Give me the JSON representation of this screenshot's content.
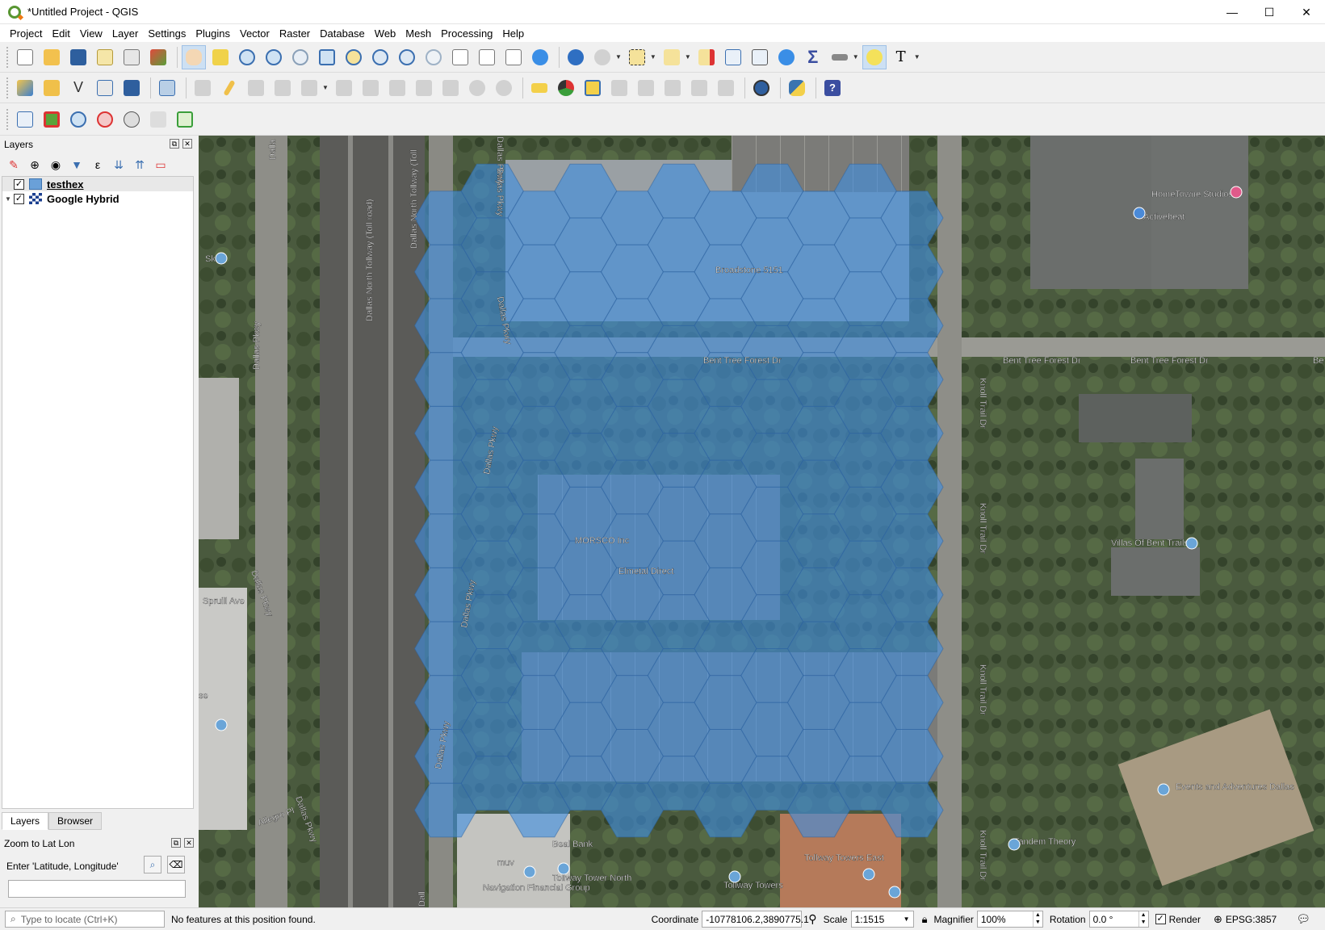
{
  "window": {
    "title": "*Untitled Project - QGIS",
    "minimize": "—",
    "maximize": "☐",
    "close": "✕"
  },
  "menu": [
    "Project",
    "Edit",
    "View",
    "Layer",
    "Settings",
    "Plugins",
    "Vector",
    "Raster",
    "Database",
    "Web",
    "Mesh",
    "Processing",
    "Help"
  ],
  "layers_panel": {
    "title": "Layers",
    "layers": [
      {
        "name": "testhex",
        "checked": true,
        "selected": true
      },
      {
        "name": "Google Hybrid",
        "checked": true,
        "selected": false
      }
    ]
  },
  "tabs": {
    "layers": "Layers",
    "browser": "Browser"
  },
  "zoom_panel": {
    "title": "Zoom to Lat Lon",
    "prompt": "Enter 'Latitude, Longitude'",
    "value": ""
  },
  "map": {
    "hex_color": "#3f8ee0",
    "labels": {
      "dnt1": "Dallas North Tollway (Toll road)",
      "dnt2": "Dallas North Tollway (Toll",
      "dallas_pkwy_top": "Dallas Pkwy",
      "dallas_pkwy_left": "Dallas Pkwy",
      "dallas_pkwy_left2": "Dallas Pkwy",
      "dallas_pkwy_bottom": "Dallas Pkwy",
      "dallas_pkwy_mid1": "Dallas Pkwy",
      "dallas_pkwy_mid2": "Dallas Pkwy",
      "dallas_pkwy_mid3": "Dallas Pkwy",
      "dallas_pkwy_mid4": "Dallas Pkwy",
      "dallas_pkwy_top2": "Dallas Pkwy",
      "dalla_top": "Dalla",
      "dall_bottom": "Dall",
      "broadstone": "Broadstone 5151",
      "bent_tree_center": "Bent Tree Forest Dr",
      "bent_tree_right1": "Bent Tree Forest Dr",
      "bent_tree_right2": "Bent Tree Forest Dr",
      "be": "Be",
      "knoll1": "Knoll Trail Dr",
      "knoll2": "Knoll Trail Dr",
      "knoll3": "Knoll Trail Dr",
      "knoll4": "Knoll Trail Dr",
      "hometowne": "HomeTowne Studios",
      "activebeat": "Activebeat",
      "villas": "Villas Of Bent Trails",
      "morsco": "MORSCO Inc",
      "elmetal": "Elmetal Direct",
      "spruill": "Spruill Ave",
      "allegro": "Allegro Pl",
      "events": "Events and Adventures Dallas",
      "tandem": "Tandem Theory",
      "tollway_towers_east": "Tollway Towers East",
      "tollway_towers": "Tollway Towers",
      "tollway_tower_north": "Tollway Tower North",
      "navigation": "Navigation Financial Group",
      "beal": "Beal Bank",
      "muv": "muv",
      "sk": "Sk",
      "se": "se"
    }
  },
  "status": {
    "locator_placeholder": "Type to locate (Ctrl+K)",
    "message": "No features at this position found.",
    "coordinate_label": "Coordinate",
    "coordinate": "-10778106.2,3890775.1",
    "scale_label": "Scale",
    "scale": "1:1515",
    "magnifier_label": "Magnifier",
    "magnifier": "100%",
    "rotation_label": "Rotation",
    "rotation": "0.0 °",
    "render_label": "Render",
    "crs": "EPSG:3857"
  }
}
